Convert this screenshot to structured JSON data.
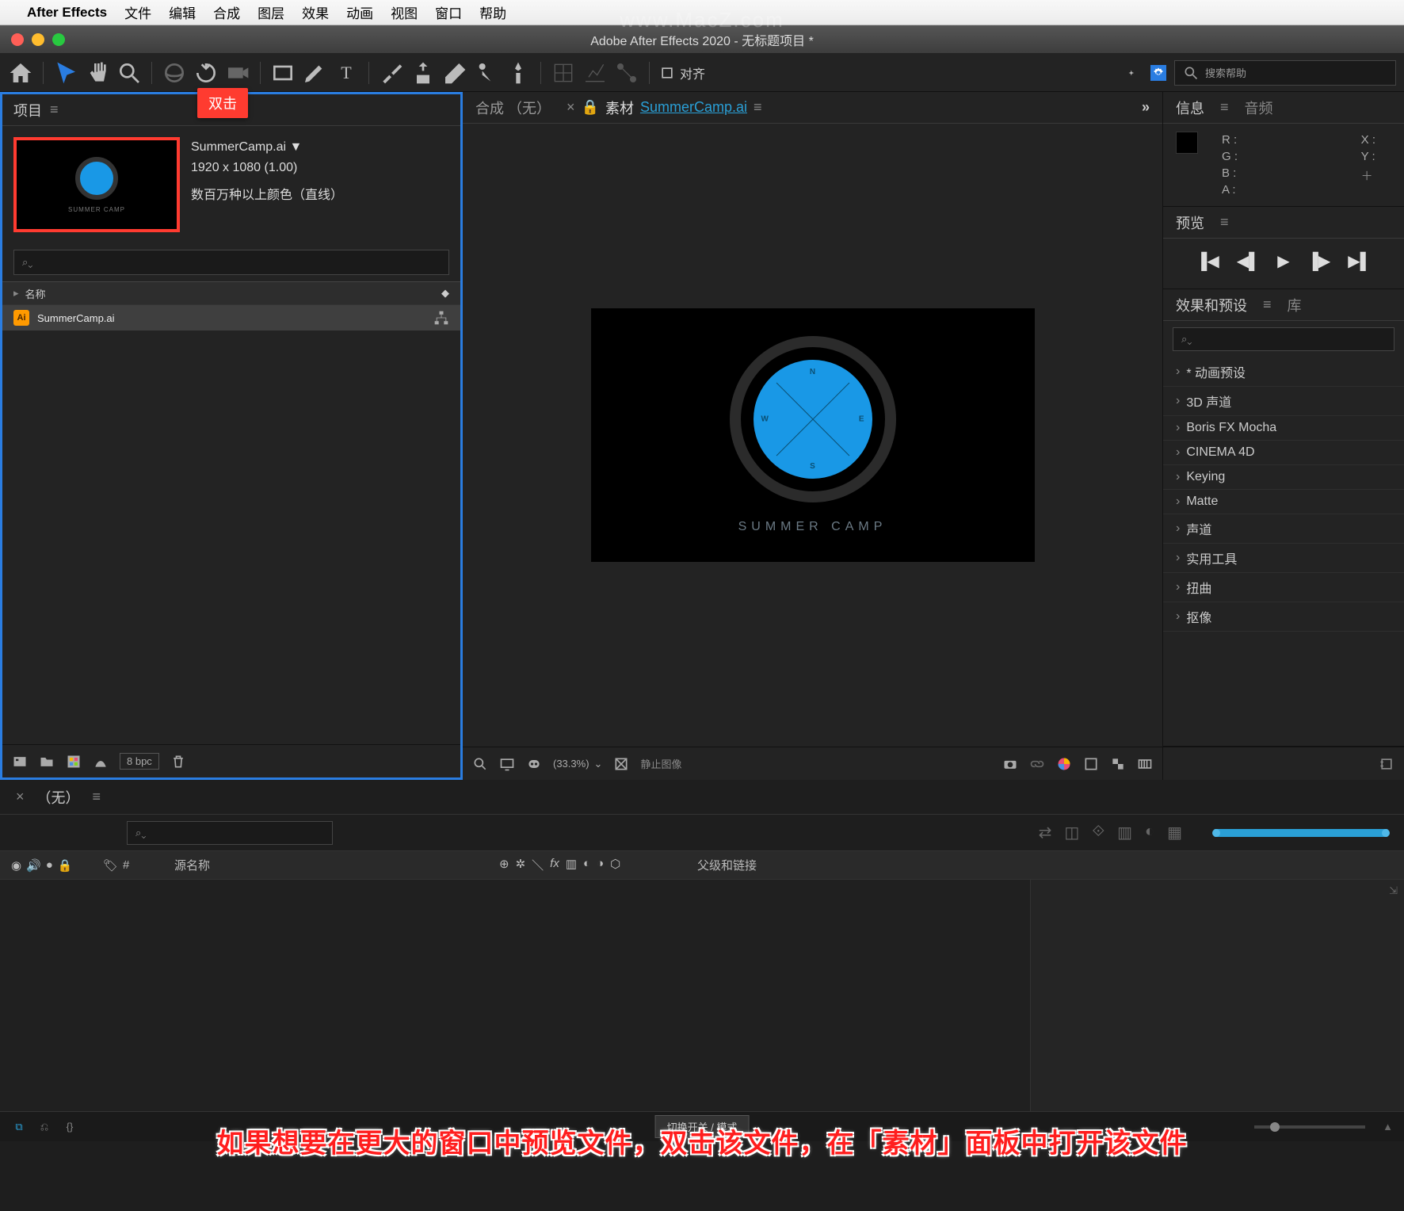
{
  "menubar": {
    "apple": "",
    "appname": "After Effects",
    "items": [
      "文件",
      "编辑",
      "合成",
      "图层",
      "效果",
      "动画",
      "视图",
      "窗口",
      "帮助"
    ]
  },
  "window": {
    "title": "Adobe After Effects 2020 - 无标题项目 *"
  },
  "toolbar": {
    "align_label": "对齐",
    "search_placeholder": "搜索帮助"
  },
  "project": {
    "tab": "项目",
    "callout": "双击",
    "asset": {
      "name": "SummerCamp.ai",
      "size": "1920 x 1080 (1.00)",
      "colors": "数百万种以上颜色（直线）",
      "thumb_text": "SUMMER CAMP"
    },
    "header_name": "名称",
    "rows": [
      {
        "name": "SummerCamp.ai",
        "icon_label": "Ai"
      }
    ],
    "footer": {
      "bpc": "8 bpc"
    }
  },
  "composition": {
    "tab_inactive": "合成 （无）",
    "tab_active_prefix": "素材",
    "tab_active_file": "SummerCamp.ai",
    "canvas_title": "SUMMER CAMP",
    "dirs": {
      "n": "N",
      "s": "S",
      "e": "E",
      "w": "W"
    },
    "footer": {
      "zoom": "(33.3%)",
      "still": "静止图像"
    }
  },
  "info": {
    "tab_info": "信息",
    "tab_audio": "音频",
    "r": "R :",
    "g": "G :",
    "b": "B :",
    "a": "A :",
    "x": "X :",
    "y": "Y :"
  },
  "preview": {
    "tab": "预览"
  },
  "effects": {
    "tab_effects": "效果和预设",
    "tab_lib": "库",
    "items": [
      "* 动画预设",
      "3D 声道",
      "Boris FX Mocha",
      "CINEMA 4D",
      "Keying",
      "Matte",
      "声道",
      "实用工具",
      "扭曲",
      "抠像"
    ]
  },
  "timeline": {
    "tab": "（无）",
    "col_source": "源名称",
    "col_parent": "父级和链接",
    "hash": "#",
    "toggle": "切换开关 / 模式"
  },
  "caption": "如果想要在更大的窗口中预览文件，双击该文件，在「素材」面板中打开该文件",
  "watermark": "www.MacZ.com"
}
